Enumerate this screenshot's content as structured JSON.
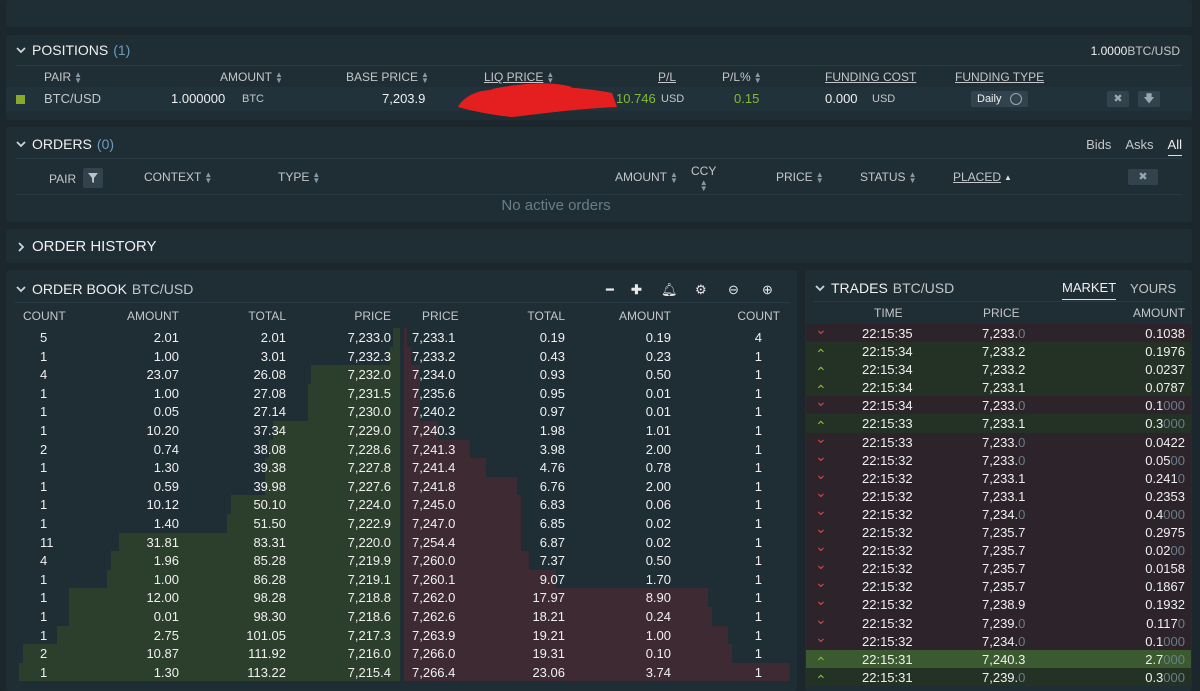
{
  "positions": {
    "title": "POSITIONS",
    "count": "(1)",
    "balance_value": "1.0000",
    "balance_unit": "BTC/USD",
    "columns": [
      "PAIR",
      "AMOUNT",
      "BASE PRICE",
      "LIQ PRICE",
      "P/L",
      "P/L%",
      "FUNDING COST",
      "FUNDING TYPE"
    ],
    "row": {
      "pair": "BTC/USD",
      "amount_main": "1.000000",
      "amount_unit": "BTC",
      "base_price": "7,203.9",
      "pl": "10.746",
      "pl_unit": "USD",
      "pl_pct": "0.15",
      "funding_cost": "0.000",
      "funding_unit": "USD",
      "funding_type": "Daily"
    }
  },
  "orders": {
    "title": "ORDERS",
    "count": "(0)",
    "tabs": [
      "Bids",
      "Asks",
      "All"
    ],
    "columns": [
      "PAIR",
      "CONTEXT",
      "TYPE",
      "AMOUNT",
      "CCY",
      "PRICE",
      "STATUS",
      "PLACED"
    ],
    "empty_text": "No active orders"
  },
  "order_history": {
    "title": "ORDER HISTORY"
  },
  "order_book": {
    "title": "ORDER BOOK",
    "pair": "BTC/USD",
    "columns": [
      "COUNT",
      "AMOUNT",
      "TOTAL",
      "PRICE",
      "PRICE",
      "TOTAL",
      "AMOUNT",
      "COUNT"
    ],
    "bids": [
      [
        "5",
        "2.01",
        "2.01",
        "7,233.0"
      ],
      [
        "1",
        "1.00",
        "3.01",
        "7,232.3"
      ],
      [
        "4",
        "23.07",
        "26.08",
        "7,232.0"
      ],
      [
        "1",
        "1.00",
        "27.08",
        "7,231.5"
      ],
      [
        "1",
        "0.05",
        "27.14",
        "7,230.0"
      ],
      [
        "1",
        "10.20",
        "37.34",
        "7,229.0"
      ],
      [
        "2",
        "0.74",
        "38.08",
        "7,228.6"
      ],
      [
        "1",
        "1.30",
        "39.38",
        "7,227.8"
      ],
      [
        "1",
        "0.59",
        "39.98",
        "7,227.6"
      ],
      [
        "1",
        "10.12",
        "50.10",
        "7,224.0"
      ],
      [
        "1",
        "1.40",
        "51.50",
        "7,222.9"
      ],
      [
        "11",
        "31.81",
        "83.31",
        "7,220.0"
      ],
      [
        "4",
        "1.96",
        "85.28",
        "7,219.9"
      ],
      [
        "1",
        "1.00",
        "86.28",
        "7,219.1"
      ],
      [
        "1",
        "12.00",
        "98.28",
        "7,218.8"
      ],
      [
        "1",
        "0.01",
        "98.30",
        "7,218.6"
      ],
      [
        "1",
        "2.75",
        "101.05",
        "7,217.3"
      ],
      [
        "2",
        "10.87",
        "111.92",
        "7,216.0"
      ],
      [
        "1",
        "1.30",
        "113.22",
        "7,215.4"
      ]
    ],
    "asks": [
      [
        "7,233.1",
        "0.19",
        "0.19",
        "4"
      ],
      [
        "7,233.2",
        "0.43",
        "0.23",
        "1"
      ],
      [
        "7,234.0",
        "0.93",
        "0.50",
        "1"
      ],
      [
        "7,235.6",
        "0.95",
        "0.01",
        "1"
      ],
      [
        "7,240.2",
        "0.97",
        "0.01",
        "1"
      ],
      [
        "7,240.3",
        "1.98",
        "1.01",
        "1"
      ],
      [
        "7,241.3",
        "3.98",
        "2.00",
        "1"
      ],
      [
        "7,241.4",
        "4.76",
        "0.78",
        "1"
      ],
      [
        "7,241.8",
        "6.76",
        "2.00",
        "1"
      ],
      [
        "7,245.0",
        "6.83",
        "0.06",
        "1"
      ],
      [
        "7,247.0",
        "6.85",
        "0.02",
        "1"
      ],
      [
        "7,254.4",
        "6.87",
        "0.02",
        "1"
      ],
      [
        "7,260.0",
        "7.37",
        "0.50",
        "1"
      ],
      [
        "7,260.1",
        "9.07",
        "1.70",
        "1"
      ],
      [
        "7,262.0",
        "17.97",
        "8.90",
        "1"
      ],
      [
        "7,262.6",
        "18.21",
        "0.24",
        "1"
      ],
      [
        "7,263.9",
        "19.21",
        "1.00",
        "1"
      ],
      [
        "7,266.0",
        "19.31",
        "0.10",
        "1"
      ],
      [
        "7,266.4",
        "23.06",
        "3.74",
        "1"
      ]
    ],
    "bid_depth": [
      0.018,
      0.026,
      0.23,
      0.24,
      0.24,
      0.33,
      0.34,
      0.35,
      0.35,
      0.44,
      0.45,
      0.73,
      0.75,
      0.76,
      0.86,
      0.86,
      0.89,
      0.98,
      0.99
    ],
    "ask_depth": [
      0.008,
      0.019,
      0.04,
      0.041,
      0.042,
      0.086,
      0.17,
      0.21,
      0.29,
      0.3,
      0.3,
      0.3,
      0.32,
      0.39,
      0.78,
      0.79,
      0.83,
      0.84,
      1.0
    ]
  },
  "trades": {
    "title": "TRADES",
    "pair": "BTC/USD",
    "tabs": [
      "MARKET",
      "YOURS"
    ],
    "columns": [
      "TIME",
      "PRICE",
      "AMOUNT"
    ],
    "rows": [
      [
        "down",
        "22:15:35",
        "7,233.",
        "0",
        "0.1038",
        ""
      ],
      [
        "up",
        "22:15:34",
        "7,233.2",
        "",
        "0.1976",
        ""
      ],
      [
        "up",
        "22:15:34",
        "7,233.2",
        "",
        "0.0237",
        ""
      ],
      [
        "up",
        "22:15:34",
        "7,233.1",
        "",
        "0.0787",
        ""
      ],
      [
        "down",
        "22:15:34",
        "7,233.",
        "0",
        "0.1",
        "000"
      ],
      [
        "up",
        "22:15:33",
        "7,233.1",
        "",
        "0.3",
        "000"
      ],
      [
        "down",
        "22:15:33",
        "7,233.",
        "0",
        "0.0422",
        ""
      ],
      [
        "down",
        "22:15:32",
        "7,233.",
        "0",
        "0.05",
        "00"
      ],
      [
        "down",
        "22:15:32",
        "7,233.1",
        "",
        "0.241",
        "0"
      ],
      [
        "down",
        "22:15:32",
        "7,233.1",
        "",
        "0.2353",
        ""
      ],
      [
        "down",
        "22:15:32",
        "7,234.",
        "0",
        "0.4",
        "000"
      ],
      [
        "down",
        "22:15:32",
        "7,235.7",
        "",
        "0.2975",
        ""
      ],
      [
        "down",
        "22:15:32",
        "7,235.7",
        "",
        "0.02",
        "00"
      ],
      [
        "down",
        "22:15:32",
        "7,235.7",
        "",
        "0.0158",
        ""
      ],
      [
        "down",
        "22:15:32",
        "7,235.7",
        "",
        "0.1867",
        ""
      ],
      [
        "down",
        "22:15:32",
        "7,238.9",
        "",
        "0.1932",
        ""
      ],
      [
        "down",
        "22:15:32",
        "7,239.",
        "0",
        "0.117",
        "0"
      ],
      [
        "down",
        "22:15:32",
        "7,234.",
        "0",
        "0.1",
        "000"
      ],
      [
        "up",
        "22:15:31",
        "7,240.3",
        "",
        "2.7",
        "000"
      ],
      [
        "up",
        "22:15:31",
        "7,239.",
        "0",
        "0.3",
        "000"
      ]
    ]
  }
}
